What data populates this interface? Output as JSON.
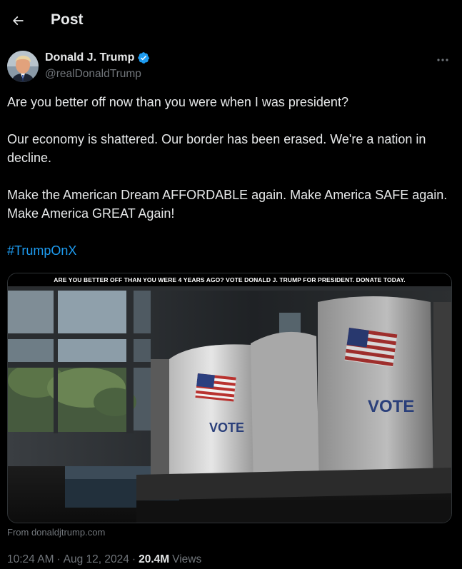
{
  "header": {
    "title": "Post"
  },
  "author": {
    "display_name": "Donald J. Trump",
    "handle": "@realDonaldTrump",
    "verified": true,
    "verified_color": "#1d9bf0"
  },
  "tweet": {
    "paragraphs": [
      "Are you better off now than you were when I was president?",
      "Our economy is shattered. Our border has been erased. We're a nation in decline.",
      "Make the American Dream AFFORDABLE again. Make America SAFE again. Make America GREAT Again!"
    ],
    "hashtag": "#TrumpOnX"
  },
  "media": {
    "banner_text": "ARE YOU BETTER OFF THAN YOU WERE 4 YEARS AGO?  VOTE DONALD J. TRUMP FOR PRESIDENT. DONATE TODAY.",
    "booth_label_left": "VOTE",
    "booth_label_right": "VOTE"
  },
  "source": "From donaldjtrump.com",
  "meta": {
    "time": "10:24 AM",
    "separator": "·",
    "date": "Aug 12, 2024",
    "views_count": "20.4M",
    "views_label": "Views"
  },
  "colors": {
    "background": "#000000",
    "text": "#e7e9ea",
    "muted": "#71767b",
    "accent": "#1d9bf0"
  },
  "icons": {
    "back": "arrow-left-icon",
    "verified": "verified-badge-icon",
    "more": "more-horizontal-icon"
  }
}
